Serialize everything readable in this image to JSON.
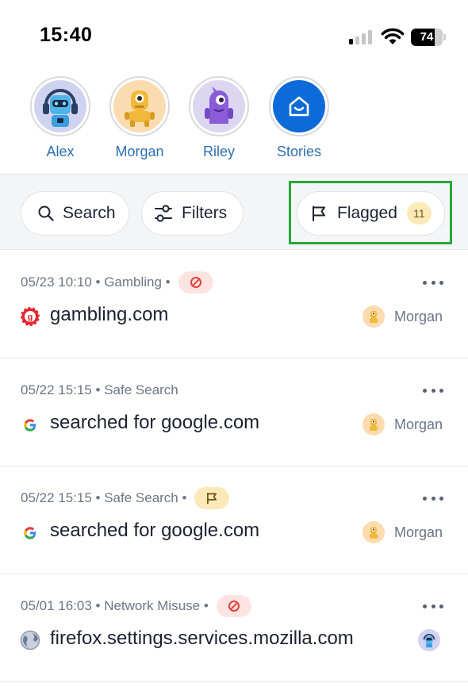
{
  "status_bar": {
    "time": "15:40",
    "battery": "74",
    "battery_level": 0.74,
    "signal_bars_active": 1
  },
  "profiles": [
    {
      "name": "Alex",
      "avatar": "blue-robot-headphones-avatar",
      "bg": "#cfd3ef"
    },
    {
      "name": "Morgan",
      "avatar": "yellow-one-eyed-robot-avatar",
      "bg": "#fbdcb0"
    },
    {
      "name": "Riley",
      "avatar": "purple-monster-avatar",
      "bg": "#dcd6f0"
    },
    {
      "name": "Stories",
      "avatar": "house-smile-icon",
      "bg": "#0d6ad9"
    }
  ],
  "actions": {
    "search_label": "Search",
    "filters_label": "Filters",
    "flagged_label": "Flagged",
    "flagged_count": "11"
  },
  "activities": [
    {
      "meta": "05/23 10:10 • Gambling •",
      "status": "blocked",
      "site_icon": "gambling-chip-icon",
      "title": "gambling.com",
      "user": "Morgan"
    },
    {
      "meta": "05/22 15:15 • Safe Search",
      "status": "",
      "site_icon": "google-icon",
      "title": "searched for google.com",
      "user": "Morgan"
    },
    {
      "meta": "05/22 15:15 • Safe Search •",
      "status": "flagged",
      "site_icon": "google-icon",
      "title": "searched for google.com",
      "user": "Morgan"
    },
    {
      "meta": "05/01 16:03 • Network Misuse •",
      "status": "blocked",
      "site_icon": "globe-icon",
      "title": "firefox.settings.services.mozilla.com",
      "user": ""
    }
  ],
  "colors": {
    "link_blue": "#2e6fb2",
    "highlight_green": "#27a73b",
    "blocked_red": "#e2413a",
    "flag_yellow": "#fbe9b8"
  }
}
